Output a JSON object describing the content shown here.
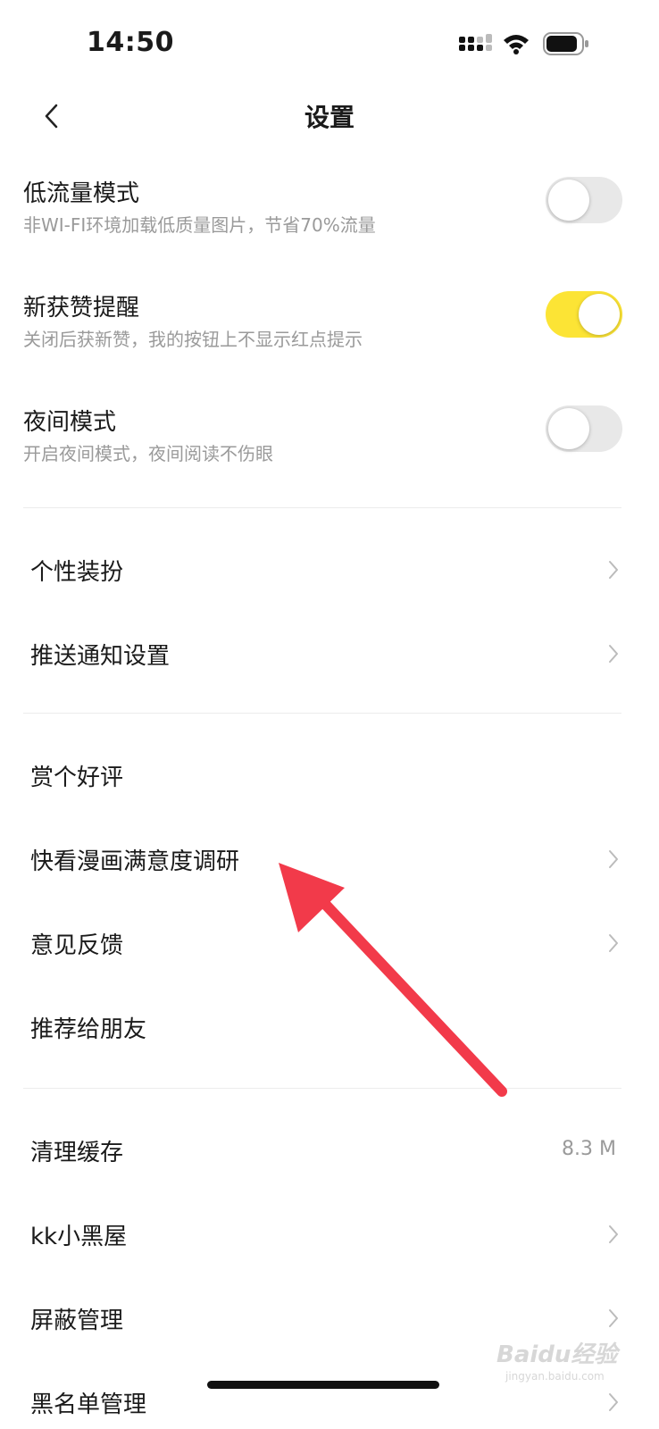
{
  "status_bar": {
    "time": "14:50",
    "icons": [
      "signal-icon",
      "wifi-icon",
      "battery-icon"
    ]
  },
  "nav": {
    "title": "设置",
    "back_icon": "chevron-left-icon"
  },
  "toggles": [
    {
      "title": "低流量模式",
      "subtitle": "非WI-FI环境加载低质量图片，节省70%流量",
      "on": false
    },
    {
      "title": "新获赞提醒",
      "subtitle": "关闭后获新赞，我的按钮上不显示红点提示",
      "on": true
    },
    {
      "title": "夜间模式",
      "subtitle": "开启夜间模式，夜间阅读不伤眼",
      "on": false
    }
  ],
  "group1": [
    {
      "label": "个性装扮",
      "chevron": true
    },
    {
      "label": "推送通知设置",
      "chevron": true
    }
  ],
  "group2": [
    {
      "label": "赏个好评",
      "chevron": false
    },
    {
      "label": "快看漫画满意度调研",
      "chevron": true
    },
    {
      "label": "意见反馈",
      "chevron": true
    },
    {
      "label": "推荐给朋友",
      "chevron": false
    }
  ],
  "group3": [
    {
      "label": "清理缓存",
      "value": "8.3 M",
      "chevron": false
    },
    {
      "label": "kk小黑屋",
      "chevron": true
    },
    {
      "label": "屏蔽管理",
      "chevron": true
    },
    {
      "label": "黑名单管理",
      "chevron": true
    }
  ],
  "watermark": {
    "text": "Baidu经验",
    "sub": "jingyan.baidu.com"
  },
  "colors": {
    "toggle_on": "#fce435",
    "toggle_off": "#e8e8e8",
    "arrow": "#f23a4a"
  }
}
